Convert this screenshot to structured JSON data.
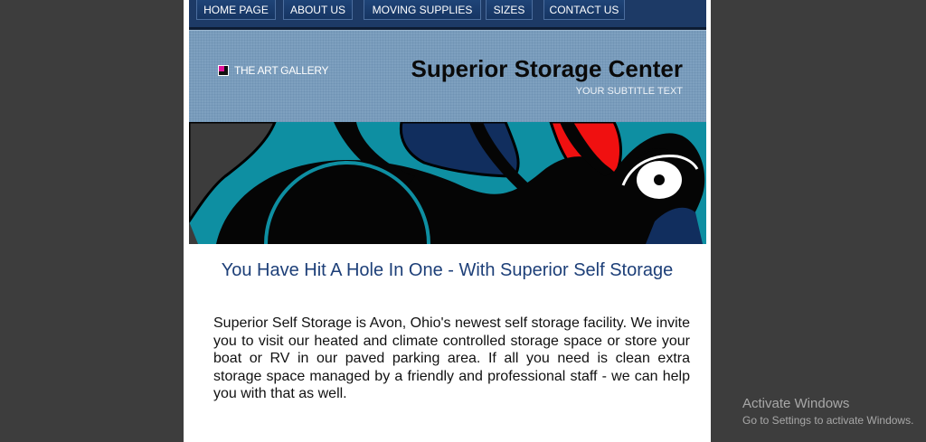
{
  "nav": {
    "items": [
      {
        "label": "HOME PAGE"
      },
      {
        "label": "ABOUT US"
      },
      {
        "label": "MOVING SUPPLIES"
      },
      {
        "label": "SIZES"
      },
      {
        "label": "CONTACT US"
      }
    ]
  },
  "header": {
    "logo_text": "THE ART GALLERY",
    "title": "Superior Storage Center",
    "subtitle": "YOUR SUBTITLE TEXT"
  },
  "main": {
    "headline": "You Have Hit A Hole In One - With Superior Self Storage",
    "paragraph": "Superior Self Storage is Avon, Ohio's newest self storage facility. We invite you to visit our heated and climate controlled storage space or store your boat or RV in our paved parking area. If all you need is clean extra storage space managed by a friendly and professional staff - we can help you with that as well."
  },
  "watermark": {
    "line1": "Activate Windows",
    "line2": "Go to Settings to activate Windows."
  },
  "colors": {
    "page_background": "#3d3d3d",
    "nav_background": "#1d3a66",
    "header_background": "#7ea0bf",
    "headline_color": "#1d3f78"
  }
}
